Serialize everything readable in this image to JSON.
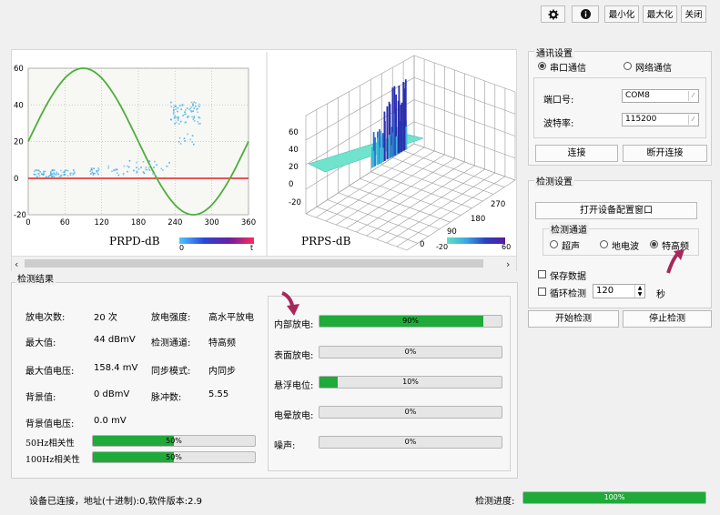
{
  "titlebar": {
    "settings_icon": "gear-icon",
    "info_icon": "info-icon",
    "minimize": "最小化",
    "maximize": "最大化",
    "close": "关闭"
  },
  "prpd": {
    "title": "PRPD-dB",
    "x_ticks": [
      "0",
      "60",
      "120",
      "180",
      "240",
      "300",
      "360"
    ],
    "y_ticks": [
      "60",
      "40",
      "20",
      "0",
      "-20"
    ],
    "colorbar_min": "0",
    "colorbar_max": "t"
  },
  "prps": {
    "title": "PRPS-dB",
    "z_ticks": [
      "60",
      "40",
      "20",
      "0",
      "-20"
    ],
    "phase_ticks": [
      "270",
      "180",
      "90",
      "0"
    ],
    "colorbar_min": "-20",
    "colorbar_max": "60"
  },
  "comm": {
    "title": "通讯设置",
    "serial": "串口通信",
    "network": "网络通信",
    "port_label": "端口号:",
    "port_value": "COM8",
    "baud_label": "波特率:",
    "baud_value": "115200",
    "connect": "连接",
    "disconnect": "断开连接"
  },
  "detect": {
    "title": "检测设置",
    "open_config": "打开设备配置窗口",
    "channel_title": "检测通道",
    "ch_ultrasonic": "超声",
    "ch_tev": "地电波",
    "ch_uhf": "特高频",
    "save_data": "保存数据",
    "loop_detect": "循环检测",
    "loop_value": "120",
    "loop_unit": "秒",
    "start": "开始检测",
    "stop": "停止检测"
  },
  "results": {
    "title": "检测结果",
    "discharge_count_label": "放电次数:",
    "discharge_count_value": "20 次",
    "intensity_label": "放电强度:",
    "intensity_value": "高水平放电",
    "max_label": "最大值:",
    "max_value": "44 dBmV",
    "channel_label": "检测通道:",
    "channel_value": "特高频",
    "max_voltage_label": "最大值电压:",
    "max_voltage_value": "158.4 mV",
    "sync_label": "同步模式:",
    "sync_value": "内同步",
    "bg_label": "背景值:",
    "bg_value": "0 dBmV",
    "pulse_label": "脉冲数:",
    "pulse_value": "5.55",
    "bg_voltage_label": "背景值电压:",
    "bg_voltage_value": "0.0 mV",
    "corr50_label": "50Hz相关性",
    "corr50_value": 0.5,
    "corr50_text": "50%",
    "corr100_label": "100Hz相关性",
    "corr100_value": 0.5,
    "corr100_text": "50%"
  },
  "types": [
    {
      "label": "内部放电:",
      "value": 0.9,
      "text": "90%"
    },
    {
      "label": "表面放电:",
      "value": 0.0,
      "text": "0%"
    },
    {
      "label": "悬浮电位:",
      "value": 0.1,
      "text": "10%"
    },
    {
      "label": "电晕放电:",
      "value": 0.0,
      "text": "0%"
    },
    {
      "label": "噪声:",
      "value": 0.0,
      "text": "0%"
    }
  ],
  "status": {
    "text": "设备已连接，地址(十进制):0,软件版本:2.9",
    "progress_label": "检测进度:",
    "progress_value": 1.0,
    "progress_text": "100%"
  },
  "colors": {
    "accent_green": "#1faa3a",
    "arrow": "#a8285a",
    "sine": "#4caf3a",
    "zero_line": "#e02020"
  }
}
